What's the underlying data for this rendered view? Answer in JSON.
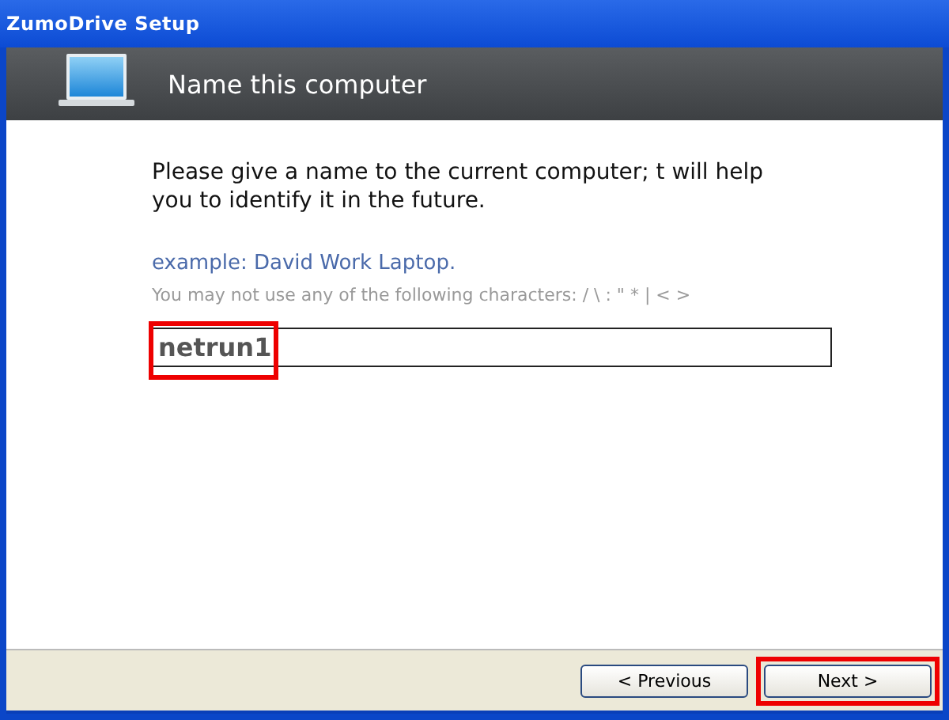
{
  "window": {
    "title": "ZumoDrive Setup"
  },
  "header": {
    "title": "Name this computer"
  },
  "body": {
    "instruction": "Please give a name to the current computer;  t will help you to identify it in the future.",
    "example": "example: David Work Laptop.",
    "restriction": "You may not use any of the following characters: / \\ : \" * | < >"
  },
  "name_field": {
    "value": "netrun1",
    "highlighted": true
  },
  "buttons": [
    {
      "label": "< Previous",
      "highlighted": false
    },
    {
      "label": "Next >",
      "highlighted": true
    }
  ]
}
